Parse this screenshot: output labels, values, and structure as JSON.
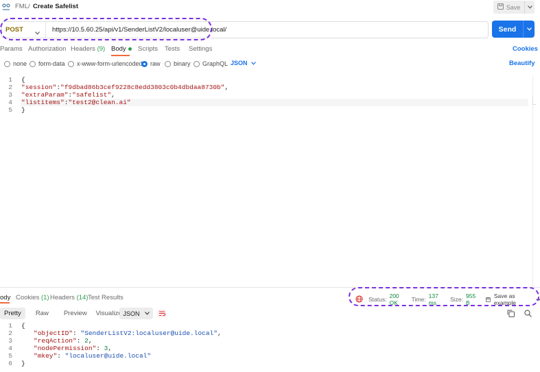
{
  "breadcrumb": {
    "parent": "FML",
    "separator": "/",
    "title": "Create Safelist"
  },
  "toolbar": {
    "save_label": "Save"
  },
  "request": {
    "method": "POST",
    "url": "https://10.5.60.25/api/v1/SenderListV2/localuser@uide.local/",
    "send_label": "Send"
  },
  "tabs": {
    "params": "Params",
    "authorization": "Authorization",
    "headers": "Headers",
    "headers_count": "(9)",
    "body": "Body",
    "scripts": "Scripts",
    "tests": "Tests",
    "settings": "Settings",
    "cookies": "Cookies"
  },
  "body_types": {
    "none": "none",
    "form_data": "form-data",
    "urlencoded": "x-www-form-urlencoded",
    "raw": "raw",
    "binary": "binary",
    "graphql": "GraphQL",
    "format": "JSON",
    "beautify": "Beautify"
  },
  "request_body": {
    "open_brace": "{",
    "session_key": "\"session\"",
    "session_value": "\"f9dbad86b3cef9228c8edd3803c0b4dbdaa8730b\"",
    "extra_key": "\"extraParam\"",
    "extra_value": "\"safelist\"",
    "listitems_key": "\"listitems\"",
    "listitems_value": "\"test2@clean.ai\"",
    "close_brace": "}",
    "line_numbers": [
      "1",
      "2",
      "3",
      "4",
      "5"
    ]
  },
  "response": {
    "tabs": {
      "body": "ody",
      "cookies": "Cookies",
      "cookies_count": "(1)",
      "headers": "Headers",
      "headers_count": "(14)",
      "test_results": "Test Results"
    },
    "status_label": "Status:",
    "status_value": "200 OK",
    "time_label": "Time:",
    "time_value": "137 ms",
    "size_label": "Size:",
    "size_value": "955 B",
    "save_example": "Save as example",
    "more": "•••",
    "views": {
      "pretty": "Pretty",
      "raw": "Raw",
      "preview": "Preview",
      "visualize": "Visualize"
    },
    "format": "JSON",
    "body": {
      "open_brace": "{",
      "objectid_key": "\"objectID\"",
      "objectid_value": "\"SenderListV2:localuser@uide.local\"",
      "reqaction_key": "\"reqAction\"",
      "reqaction_value": "2",
      "nodepermission_key": "\"nodePermission\"",
      "nodepermission_value": "3",
      "mkey_key": "\"mkey\"",
      "mkey_value": "\"localuser@uide.local\"",
      "close_brace": "}",
      "line_numbers": [
        "1",
        "2",
        "3",
        "4",
        "5",
        "6"
      ]
    }
  },
  "colors": {
    "accent": "#1a73e8",
    "tab_underline": "#f26b3a",
    "highlight": "#7a2fe0",
    "status_ok": "#0b8a3e",
    "method": "#8a6a00"
  },
  "icons": [
    "request-icon",
    "save-icon",
    "chevron-down-icon",
    "wrap-lines-icon",
    "copy-icon",
    "search-icon",
    "globe-icon"
  ]
}
